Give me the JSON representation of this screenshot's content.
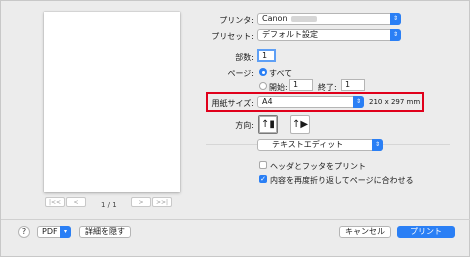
{
  "preview": {
    "nav_first": "|<<",
    "nav_prev": "<",
    "nav_next": ">",
    "nav_last": ">>|",
    "page_count": "1 / 1"
  },
  "printer": {
    "label": "プリンタ:",
    "value": "Canon"
  },
  "preset": {
    "label": "プリセット:",
    "value": "デフォルト設定"
  },
  "copies": {
    "label": "部数:",
    "value": "1"
  },
  "pages": {
    "label": "ページ:",
    "all_label": "すべて",
    "from_label": "開始:",
    "from_value": "1",
    "to_label": "終了:",
    "to_value": "1"
  },
  "paper_size": {
    "label": "用紙サイズ:",
    "value": "A4",
    "dimensions": "210 x 297 mm"
  },
  "orientation": {
    "label": "方向:"
  },
  "app_section": {
    "value": "テキストエディット"
  },
  "options": {
    "header_footer": "ヘッダとフッタをプリント",
    "rewrap": "内容を再度折り返してページに合わせる"
  },
  "footer": {
    "help": "?",
    "pdf": "PDF",
    "hide_details": "詳細を隠す",
    "cancel": "キャンセル",
    "print": "プリント"
  }
}
